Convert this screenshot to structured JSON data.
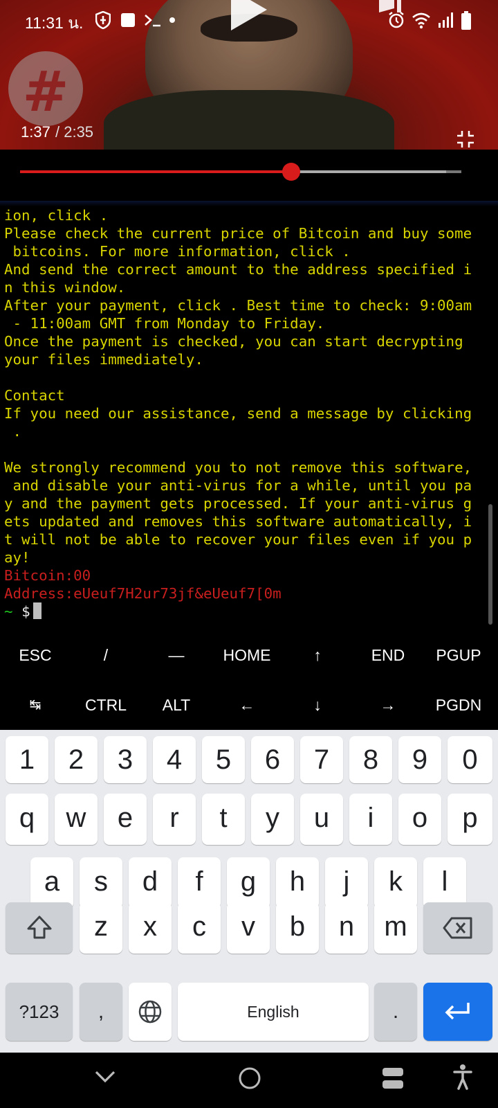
{
  "status_bar": {
    "time": "11:31 น.",
    "icons": [
      "shield-icon",
      "square-notification-icon",
      "terminal-icon",
      "dot-icon",
      "alarm-icon",
      "wifi-icon",
      "signal-icon",
      "battery-icon"
    ]
  },
  "video": {
    "time_current": "1:37",
    "time_total": "/ 2:35",
    "progress_fraction": 0.615,
    "buffered_fraction": 0.965,
    "logo_glyph": "#",
    "colors": {
      "played": "#d81c1c",
      "track": "#777777"
    }
  },
  "terminal": {
    "lines": [
      "ion, click .",
      "Please check the current price of Bitcoin and buy some",
      " bitcoins. For more information, click .",
      "And send the correct amount to the address specified i",
      "n this window.",
      "After your payment, click . Best time to check: 9:00am",
      " - 11:00am GMT from Monday to Friday.",
      "Once the payment is checked, you can start decrypting",
      "your files immediately.",
      "",
      "Contact",
      "If you need our assistance, send a message by clicking",
      " .",
      "",
      "We strongly recommend you to not remove this software,",
      " and disable your anti-virus for a while, until you pa",
      "y and the payment gets processed. If your anti-virus g",
      "ets updated and removes this software automatically, i",
      "t will not be able to recover your files even if you p",
      "ay!"
    ],
    "red_lines": [
      "Bitcoin:00",
      "Address:eUeuf7H2ur73jf&eUeuf7[0m"
    ],
    "prompt_tilde": "~",
    "prompt_dollar": "$",
    "colors": {
      "text": "#d8d400",
      "red": "#c81e1e",
      "prompt": "#1ec81e"
    }
  },
  "extra_keys": {
    "row1": [
      "ESC",
      "/",
      "—",
      "HOME",
      "↑",
      "END",
      "PGUP"
    ],
    "row2": [
      "↹",
      "CTRL",
      "ALT",
      "←",
      "↓",
      "→",
      "PGDN"
    ]
  },
  "keyboard": {
    "numbers": [
      "1",
      "2",
      "3",
      "4",
      "5",
      "6",
      "7",
      "8",
      "9",
      "0"
    ],
    "row1": [
      "q",
      "w",
      "e",
      "r",
      "t",
      "y",
      "u",
      "i",
      "o",
      "p"
    ],
    "row2": [
      "a",
      "s",
      "d",
      "f",
      "g",
      "h",
      "j",
      "k",
      "l"
    ],
    "row3": [
      "z",
      "x",
      "c",
      "v",
      "b",
      "n",
      "m"
    ],
    "symbols_label": "?123",
    "comma": ",",
    "space_label": "English",
    "period": ".",
    "colors": {
      "enter": "#1a73e8",
      "background": "#e8eaed"
    }
  },
  "nav_bar": {
    "icons": [
      "chevron-down-icon",
      "home-circle-icon",
      "recents-icon",
      "accessibility-icon"
    ]
  }
}
